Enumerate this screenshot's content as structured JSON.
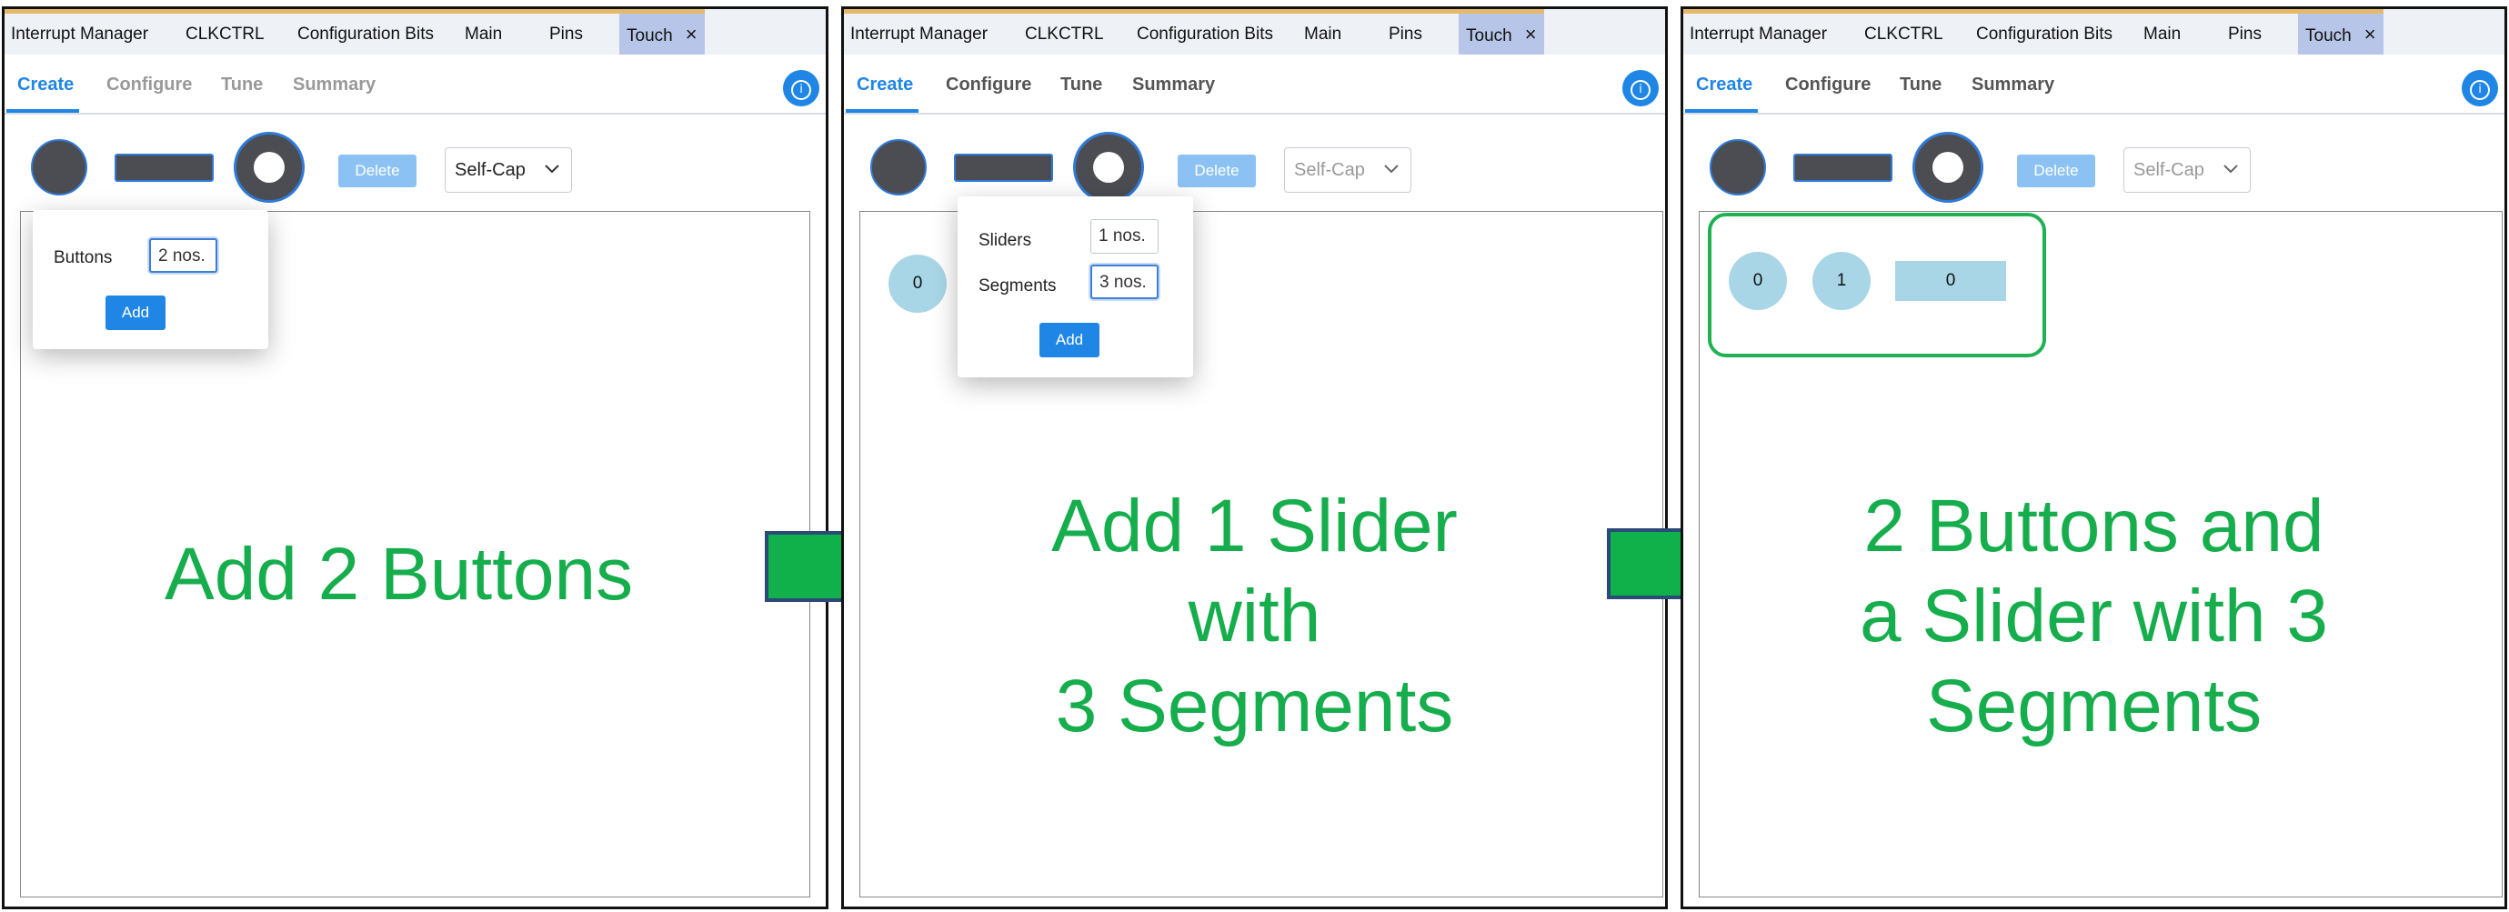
{
  "tabs": [
    "Interrupt Manager",
    "CLKCTRL",
    "Configuration Bits",
    "Main",
    "Pins",
    "Touch"
  ],
  "tab_close_icon": "×",
  "subtabs": [
    "Create",
    "Configure",
    "Tune",
    "Summary"
  ],
  "info_icon": "i",
  "toolbar": {
    "delete_label": "Delete",
    "sensing_mode": "Self-Cap"
  },
  "panel1": {
    "popup": {
      "buttons_label": "Buttons",
      "buttons_value": "2 nos.",
      "add_label": "Add"
    },
    "caption": "Add 2 Buttons"
  },
  "panel2": {
    "canvas_button": "0",
    "popup": {
      "sliders_label": "Sliders",
      "sliders_value": "1 nos.",
      "segments_label": "Segments",
      "segments_value": "3 nos.",
      "add_label": "Add"
    },
    "caption": [
      "Add 1 Slider",
      "with",
      "3 Segments"
    ]
  },
  "panel3": {
    "sensors": [
      "0",
      "1"
    ],
    "slider": "0",
    "caption": [
      "2 Buttons and",
      "a Slider with 3",
      "Segments"
    ]
  },
  "colors": {
    "caption_green": "#16ad4d",
    "arrow_green": "#10b04a",
    "accent_blue": "#1f86e6",
    "sensor_blue": "#a9d6e6"
  }
}
